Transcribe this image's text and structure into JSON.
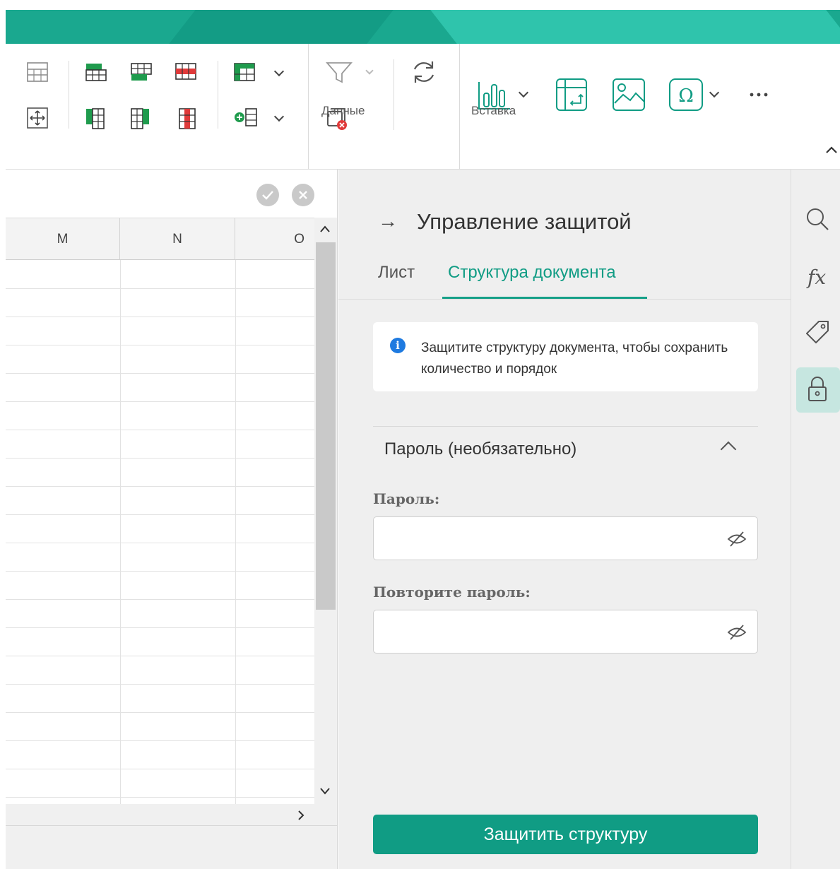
{
  "ribbon": {
    "groups": {
      "data_label": "Данные",
      "insert_label": "Вставка"
    }
  },
  "sheet": {
    "columns": [
      "M",
      "N",
      "O"
    ]
  },
  "panel": {
    "title": "Управление защитой",
    "tabs": [
      {
        "label": "Лист",
        "active": false
      },
      {
        "label": "Структура документа",
        "active": true
      }
    ],
    "info_text": "Защитите структуру документа, чтобы сохранить количество и порядок",
    "section_title": "Пароль (необязательно)",
    "password_label": "Пароль:",
    "password_value": "",
    "repeat_label": "Повторите пароль:",
    "repeat_value": "",
    "protect_button": "Защитить структуру"
  },
  "sidebar": {
    "icons": [
      "search-icon",
      "function-icon",
      "tag-icon",
      "lock-icon"
    ],
    "active": "lock-icon",
    "fx_label": "fx"
  },
  "colors": {
    "accent": "#109c84",
    "banner": "#1aa88f",
    "info": "#1e7ae0",
    "active_side": "#c6e6e0"
  }
}
